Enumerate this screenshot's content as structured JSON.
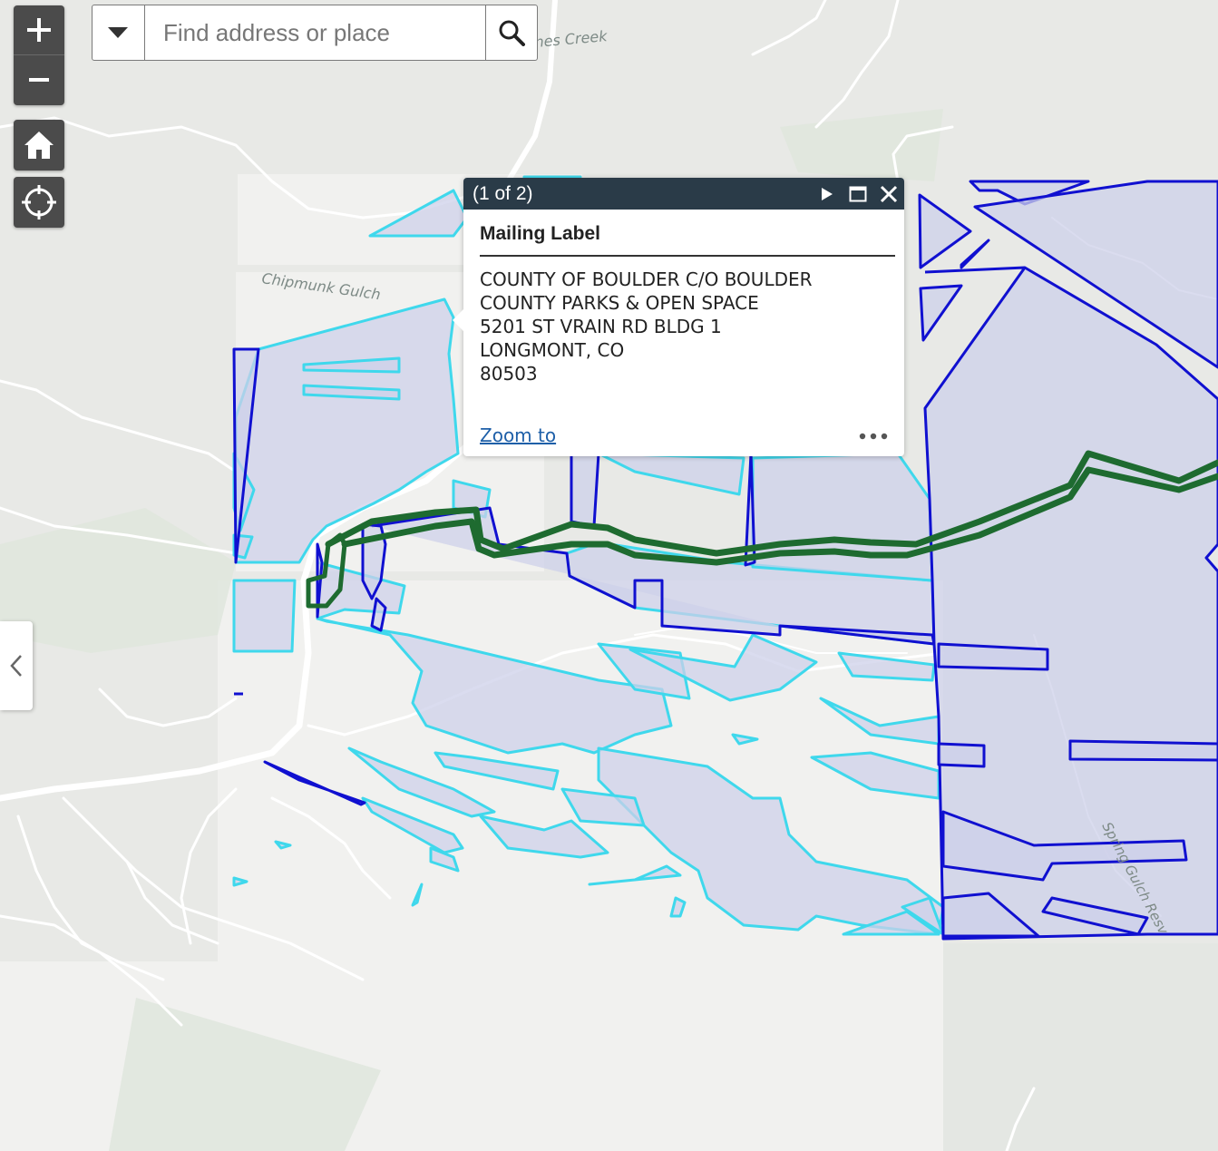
{
  "map": {
    "labels": {
      "creek": "nes Creek",
      "chipmunk": "Chipmunk Gulch",
      "spring": "Spring Gulch Resv"
    },
    "colors": {
      "background": "#e8e9e6",
      "parcel_fill": "#cdd0ea",
      "parcel_outline_blue": "#1010d0",
      "parcel_outline_cyan": "#3fd8ec",
      "trail_green": "#1e6b30",
      "road": "#ffffff"
    }
  },
  "controls": {
    "zoom_in_icon": "plus-icon",
    "zoom_out_icon": "minus-icon",
    "home_icon": "home-icon",
    "locate_icon": "locate-icon"
  },
  "search": {
    "placeholder": "Find address or place",
    "dropdown_icon": "chevron-down-icon",
    "search_icon": "search-icon"
  },
  "popup": {
    "counter": "(1 of 2)",
    "title": "Mailing Label",
    "lines": [
      "COUNTY OF BOULDER C/O BOULDER",
      "COUNTY PARKS & OPEN SPACE",
      "5201 ST VRAIN RD BLDG 1",
      "LONGMONT, CO",
      "80503"
    ],
    "zoom_link": "Zoom to",
    "next_icon": "play-icon",
    "maximize_icon": "maximize-icon",
    "close_icon": "close-icon",
    "more_icon": "more-icon"
  },
  "sidebar": {
    "toggle_icon": "chevron-left-icon"
  }
}
